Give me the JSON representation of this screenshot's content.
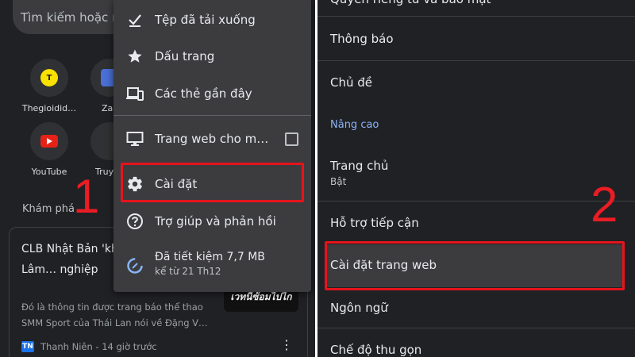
{
  "left": {
    "search_placeholder": "Tìm kiếm hoặc nhập",
    "tiles": [
      {
        "label": "Thegioidid…",
        "letter": "T"
      },
      {
        "label": "Za"
      },
      {
        "label": "YouTube"
      },
      {
        "label": "Truy"
      }
    ],
    "discover_label": "Khám phá",
    "step_number": "1",
    "card": {
      "title": "CLB Nhật Bản 'kh… mộ Đặng Văn Lâm… nghiệp",
      "description": "Đó là thông tin được trang báo thể thao SMM Sport của Thái Lan nói về Đặng V…",
      "image_text": "เวทนีซ้อมไปไก",
      "source_logo": "TN",
      "source": "Thanh Niên - 14 giờ trước",
      "more_icon": "⋮"
    },
    "menu": {
      "items": [
        {
          "label": "Tệp đã tải xuống",
          "icon": "download-check-icon"
        },
        {
          "label": "Dấu trang",
          "icon": "star-icon"
        },
        {
          "label": "Các thẻ gần đây",
          "icon": "devices-icon"
        },
        {
          "label": "Trang web cho m…",
          "icon": "desktop-icon"
        },
        {
          "label": "Cài đặt",
          "icon": "gear-icon"
        },
        {
          "label": "Trợ giúp và phản hồi",
          "icon": "help-icon"
        }
      ],
      "data_saver": {
        "title": "Đã tiết kiệm 7,7 MB",
        "subtitle": "kể từ 21 Th12",
        "icon": "data-saver-icon"
      }
    }
  },
  "right": {
    "items": [
      {
        "title": "Quyền riêng tư và bảo mật"
      },
      {
        "title": "Thông báo"
      },
      {
        "title": "Chủ đề"
      },
      {
        "title": "Trang chủ",
        "subtitle": "Bật"
      },
      {
        "title": "Hỗ trợ tiếp cận"
      },
      {
        "title": "Cài đặt trang web"
      },
      {
        "title": "Ngôn ngữ"
      },
      {
        "title": "Chế độ thu gọn"
      }
    ],
    "section_advanced": "Nâng cao",
    "step_number": "2"
  },
  "colors": {
    "background": "#202124",
    "menu": "#3c3c3f",
    "highlight": "#e5141c",
    "accent_blue": "#8ab4f8"
  }
}
